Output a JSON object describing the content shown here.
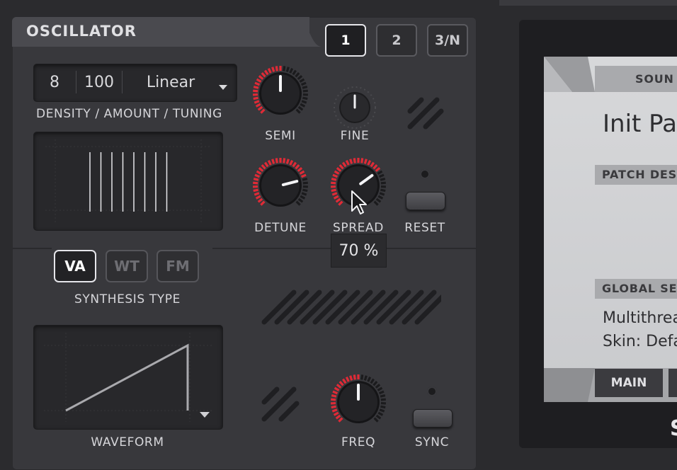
{
  "oscillator": {
    "title": "OSCILLATOR",
    "tabs": [
      {
        "label": "1",
        "active": true
      },
      {
        "label": "2",
        "active": false
      },
      {
        "label": "3/N",
        "active": false
      }
    ],
    "density": "8",
    "amount": "100",
    "tuning": "Linear",
    "density_caption": "DENSITY / AMOUNT / TUNING",
    "knobs": {
      "semi": {
        "label": "SEMI",
        "value": 0.5
      },
      "fine": {
        "label": "FINE",
        "value": 0.5
      },
      "detune": {
        "label": "DETUNE",
        "value": 0.78
      },
      "spread": {
        "label": "SPREAD",
        "value": 0.7
      },
      "freq": {
        "label": "FREQ",
        "value": 0.5
      }
    },
    "reset_label": "RESET",
    "tooltip": "70 %",
    "synthesis": {
      "caption": "SYNTHESIS TYPE",
      "types": [
        {
          "label": "VA",
          "active": true
        },
        {
          "label": "WT",
          "active": false
        },
        {
          "label": "FM",
          "active": false
        }
      ]
    },
    "waveform_caption": "WAVEFORM",
    "sync_label": "SYNC",
    "accent_color": "#e02a36"
  },
  "browser": {
    "tab_sound": "SOUN",
    "patch_name": "Init Pat",
    "patch_desc_label": "PATCH DES",
    "global_settings_label": "GLOBAL SE",
    "multithread_text": "Multithrea",
    "skin_text": "Skin: Defa",
    "main_tab": "MAIN"
  }
}
